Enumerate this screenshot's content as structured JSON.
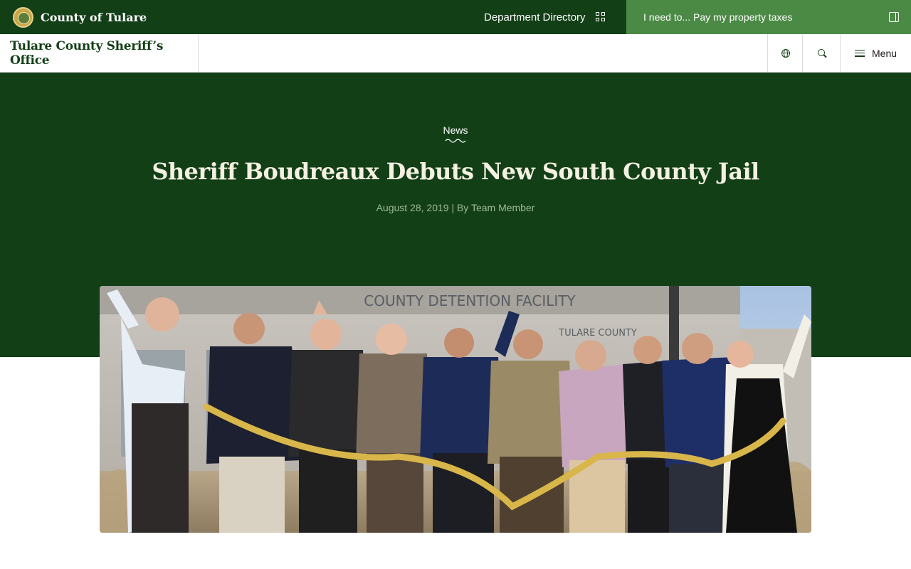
{
  "topbar": {
    "county_name": "County of Tulare",
    "department_directory_label": "Department Directory",
    "i_need_to_label": "I need to... Pay my property taxes",
    "bg_color": "#133f17",
    "accent_color": "#4b8a45"
  },
  "navbar": {
    "office_name": "Tulare County Sheriff’s Office",
    "menu_label": "Menu",
    "icons": [
      "globe-icon",
      "search-icon",
      "menu-icon"
    ]
  },
  "article": {
    "category": "News",
    "title": "Sheriff Boudreaux Debuts New South County Jail",
    "meta": "August 28, 2019 | By Team Member"
  },
  "photo": {
    "sign_text": "COUNTY DETENTION FACILITY",
    "sign_subtext": "TULARE COUNTY"
  }
}
